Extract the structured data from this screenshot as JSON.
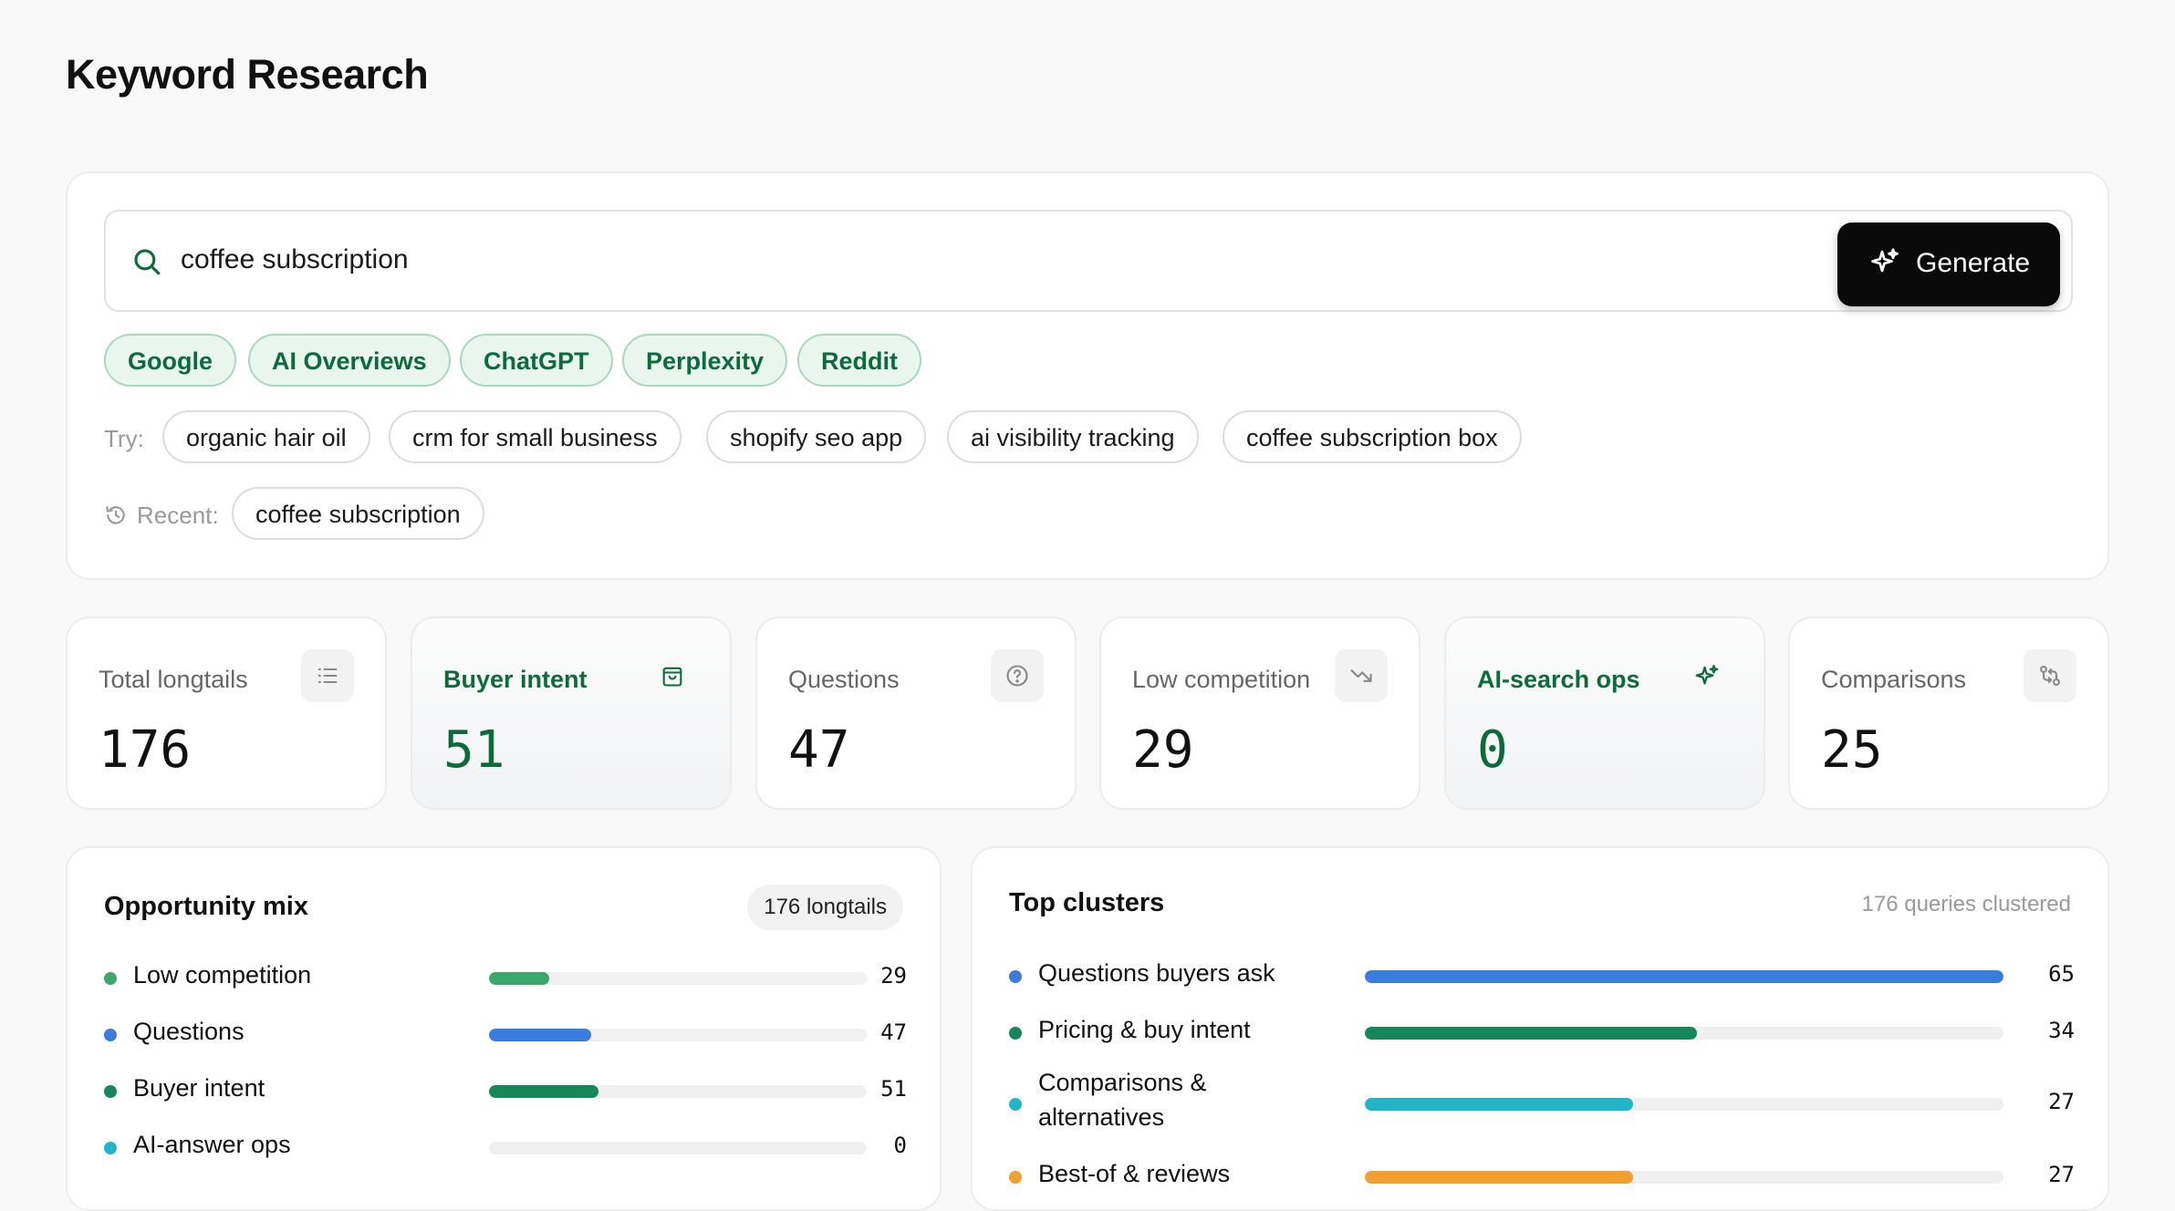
{
  "page": {
    "title": "Keyword Research"
  },
  "search": {
    "value": "coffee subscription",
    "generate_label": "Generate",
    "sources": [
      "Google",
      "AI Overviews",
      "ChatGPT",
      "Perplexity",
      "Reddit"
    ],
    "try_label": "Try:",
    "suggestions": [
      "organic hair oil",
      "crm for small business",
      "shopify seo app",
      "ai visibility tracking",
      "coffee subscription box"
    ],
    "recent_label": "Recent:",
    "recent": [
      "coffee subscription"
    ]
  },
  "stats": [
    {
      "label": "Total longtails",
      "value": "176",
      "icon": "list-icon"
    },
    {
      "label": "Buyer intent",
      "value": "51",
      "icon": "shopping-bag-icon"
    },
    {
      "label": "Questions",
      "value": "47",
      "icon": "question-circle-icon"
    },
    {
      "label": "Low competition",
      "value": "29",
      "icon": "trending-down-icon"
    },
    {
      "label": "AI-search ops",
      "value": "0",
      "icon": "sparkles-icon"
    },
    {
      "label": "Comparisons",
      "value": "25",
      "icon": "compare-arrows-icon"
    }
  ],
  "opportunity_mix": {
    "title": "Opportunity mix",
    "count_label": "176 longtails",
    "items": [
      {
        "label": "Low competition",
        "value": 29,
        "fraction": 0.16,
        "color": "#3aa86b"
      },
      {
        "label": "Questions",
        "value": 47,
        "fraction": 0.27,
        "color": "#3b7ddd"
      },
      {
        "label": "Buyer intent",
        "value": 51,
        "fraction": 0.29,
        "color": "#16875a"
      },
      {
        "label": "AI-answer ops",
        "value": 0,
        "fraction": 0.0,
        "color": "#22b5c8"
      }
    ]
  },
  "top_clusters": {
    "title": "Top clusters",
    "count_label": "176 queries clustered",
    "items": [
      {
        "label": "Questions buyers ask",
        "value": 65,
        "fraction": 1.0,
        "color": "#3b7ddd"
      },
      {
        "label": "Pricing & buy intent",
        "value": 34,
        "fraction": 0.52,
        "color": "#16875a"
      },
      {
        "label": "Comparisons &",
        "label2": "alternatives",
        "value": 27,
        "fraction": 0.42,
        "color": "#22b5c8"
      },
      {
        "label": "Best-of & reviews",
        "value": 27,
        "fraction": 0.42,
        "color": "#f0a030"
      }
    ]
  },
  "colors": {
    "accent_green": "#0c6b3b",
    "pill_bg": "#e9f6ee",
    "button_dark": "#0a0a0a"
  }
}
